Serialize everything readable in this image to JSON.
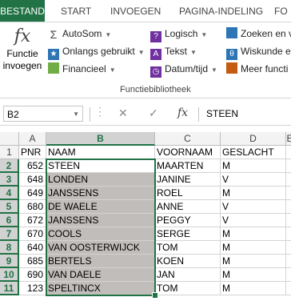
{
  "tabs": [
    "BESTAND",
    "START",
    "INVOEGEN",
    "PAGINA-INDELING",
    "FO"
  ],
  "ribbon": {
    "insert_function": [
      "Functie",
      "invoegen"
    ],
    "insert_function_icon": "fx",
    "col1": [
      "AutoSom",
      "Onlangs gebruikt",
      "Financieel"
    ],
    "col2": [
      "Logisch",
      "Tekst",
      "Datum/tijd"
    ],
    "col3": [
      "Zoeken en v",
      "Wiskunde e",
      "Meer functi"
    ],
    "group_label": "Functiebibliotheek"
  },
  "formula_bar": {
    "name_box": "B2",
    "value": "STEEN"
  },
  "columns": [
    "A",
    "B",
    "C",
    "D",
    "E"
  ],
  "rows": [
    {
      "n": "1",
      "pnr": "PNR",
      "naam": "NAAM",
      "voornaam": "VOORNAAM",
      "geslacht": "GESLACHT"
    },
    {
      "n": "2",
      "pnr": "652",
      "naam": "STEEN",
      "voornaam": "MAARTEN",
      "geslacht": "M"
    },
    {
      "n": "3",
      "pnr": "648",
      "naam": "LONDEN",
      "voornaam": "JANINE",
      "geslacht": "V"
    },
    {
      "n": "4",
      "pnr": "649",
      "naam": "JANSSENS",
      "voornaam": "ROEL",
      "geslacht": "M"
    },
    {
      "n": "5",
      "pnr": "680",
      "naam": "DE WAELE",
      "voornaam": "ANNE",
      "geslacht": "V"
    },
    {
      "n": "6",
      "pnr": "672",
      "naam": "JANSSENS",
      "voornaam": "PEGGY",
      "geslacht": "V"
    },
    {
      "n": "7",
      "pnr": "670",
      "naam": "COOLS",
      "voornaam": "SERGE",
      "geslacht": "M"
    },
    {
      "n": "8",
      "pnr": "640",
      "naam": "VAN OOSTERWIJCK",
      "voornaam": "TOM",
      "geslacht": "M"
    },
    {
      "n": "9",
      "pnr": "685",
      "naam": "BERTELS",
      "voornaam": "KOEN",
      "geslacht": "M"
    },
    {
      "n": "10",
      "pnr": "690",
      "naam": "VAN DAELE",
      "voornaam": "JAN",
      "geslacht": "M"
    },
    {
      "n": "11",
      "pnr": "123",
      "naam": "SPELTINCX",
      "voornaam": "TOM",
      "geslacht": "M"
    }
  ],
  "colors": {
    "accent": "#217346",
    "selection_fill": "#c0bdba"
  }
}
